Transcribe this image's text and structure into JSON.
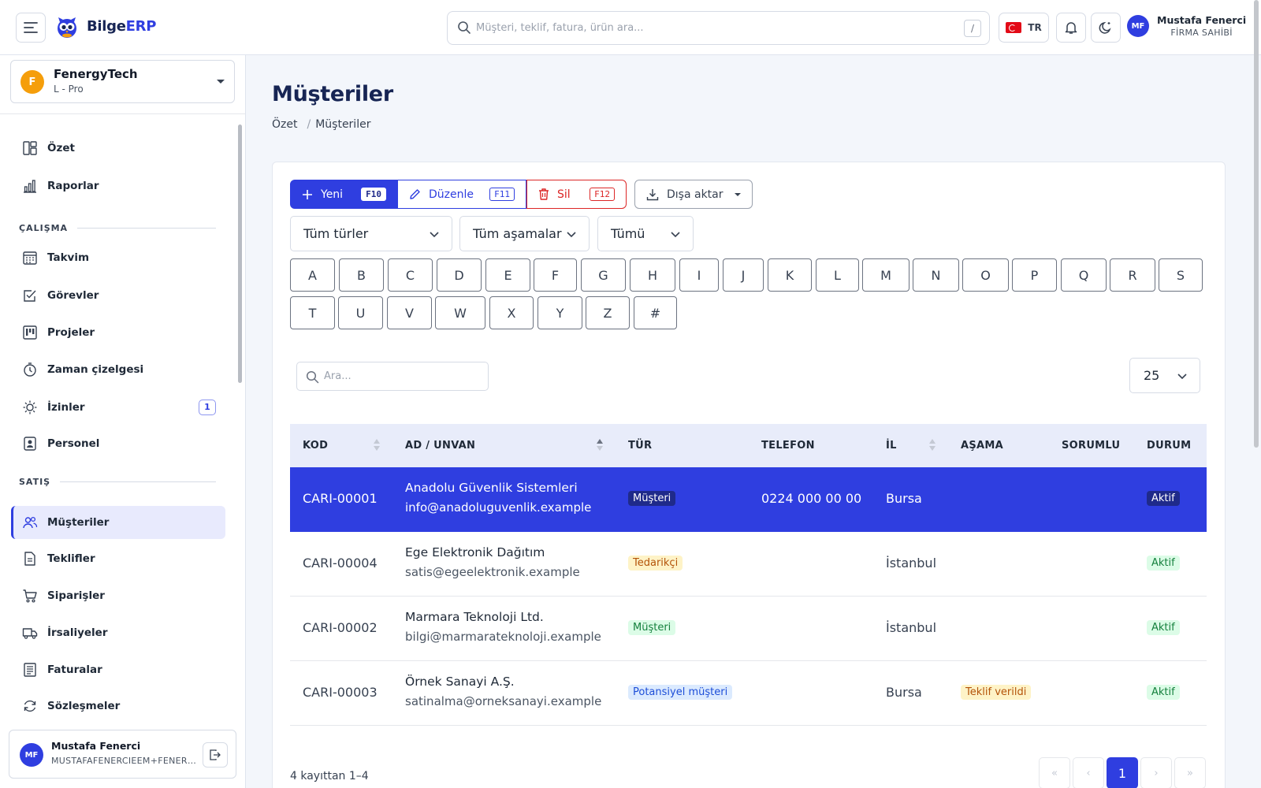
{
  "app": {
    "brand_part1": "Bilge",
    "brand_part2": "ERP"
  },
  "topbar": {
    "search_placeholder": "Müşteri, teklif, fatura, ürün ara...",
    "search_shortcut": "/",
    "language": "TR",
    "user_initials": "MF",
    "user_name": "Mustafa Fenerci",
    "user_role": "FİRMA SAHİBİ"
  },
  "company": {
    "initial": "F",
    "name": "FenergyTech",
    "plan": "L - Pro"
  },
  "sidebar": {
    "top_items": [
      {
        "label": "Özet",
        "icon": "layout-icon"
      },
      {
        "label": "Raporlar",
        "icon": "bar-chart-icon"
      }
    ],
    "sections": [
      {
        "title": "ÇALIŞMA",
        "items": [
          {
            "label": "Takvim",
            "icon": "calendar-icon"
          },
          {
            "label": "Görevler",
            "icon": "checkbox-icon"
          },
          {
            "label": "Projeler",
            "icon": "kanban-icon"
          },
          {
            "label": "Zaman çizelgesi",
            "icon": "stopwatch-icon"
          },
          {
            "label": "İzinler",
            "icon": "sun-icon",
            "badge": "1"
          },
          {
            "label": "Personel",
            "icon": "id-badge-icon"
          }
        ]
      },
      {
        "title": "SATIŞ",
        "items": [
          {
            "label": "Müşteriler",
            "icon": "users-icon",
            "active": true
          },
          {
            "label": "Teklifler",
            "icon": "document-icon"
          },
          {
            "label": "Siparişler",
            "icon": "cart-icon"
          },
          {
            "label": "İrsaliyeler",
            "icon": "truck-icon"
          },
          {
            "label": "Faturalar",
            "icon": "invoice-icon"
          },
          {
            "label": "Sözleşmeler",
            "icon": "refresh-icon"
          }
        ]
      }
    ],
    "user": {
      "initials": "MF",
      "name": "Mustafa Fenerci",
      "email": "MUSTAFAFENERCIEEM+FENERGYTECH"
    }
  },
  "page": {
    "title": "Müşteriler",
    "breadcrumb": {
      "root": "Özet",
      "separator": "/",
      "current": "Müşteriler"
    }
  },
  "toolbar": {
    "new_label": "Yeni",
    "new_key": "F10",
    "edit_label": "Düzenle",
    "edit_key": "F11",
    "delete_label": "Sil",
    "delete_key": "F12",
    "export_label": "Dışa aktar"
  },
  "filters": {
    "type": "Tüm türler",
    "stage": "Tüm aşamalar",
    "status": "Tümü"
  },
  "letters_row1": [
    "A",
    "B",
    "C",
    "D",
    "E",
    "F",
    "G",
    "H",
    "I",
    "J",
    "K",
    "L",
    "M",
    "N",
    "O",
    "P",
    "Q",
    "R",
    "S"
  ],
  "letters_row2": [
    "T",
    "U",
    "V",
    "W",
    "X",
    "Y",
    "Z",
    "#"
  ],
  "table": {
    "search_placeholder": "Ara...",
    "page_size": "25",
    "columns": {
      "code": "KOD",
      "name": "AD / UNVAN",
      "type": "TÜR",
      "phone": "TELEFON",
      "city": "İL",
      "stage": "AŞAMA",
      "owner": "SORUMLU",
      "status": "DURUM"
    },
    "rows": [
      {
        "code": "CARI-00001",
        "name": "Anadolu Güvenlik Sistemleri",
        "email": "info@anadoluguvenlik.example",
        "type": "Müşteri",
        "type_kind": "musteri",
        "phone": "0224 000 00 00",
        "city": "Bursa",
        "stage": "",
        "status": "Aktif",
        "selected": true
      },
      {
        "code": "CARI-00004",
        "name": "Ege Elektronik Dağıtım",
        "email": "satis@egeelektronik.example",
        "type": "Tedarikçi",
        "type_kind": "tedarikci",
        "phone": "",
        "city": "İstanbul",
        "stage": "",
        "status": "Aktif"
      },
      {
        "code": "CARI-00002",
        "name": "Marmara Teknoloji Ltd.",
        "email": "bilgi@marmarateknoloji.example",
        "type": "Müşteri",
        "type_kind": "musteri",
        "phone": "",
        "city": "İstanbul",
        "stage": "",
        "status": "Aktif"
      },
      {
        "code": "CARI-00003",
        "name": "Örnek Sanayi A.Ş.",
        "email": "satinalma@orneksanayi.example",
        "type": "Potansiyel müşteri",
        "type_kind": "potansiyel",
        "phone": "",
        "city": "Bursa",
        "stage": "Teklif verildi",
        "status": "Aktif"
      }
    ],
    "record_info": "4 kayıttan 1–4",
    "pagination": {
      "first": "«",
      "prev": "‹",
      "current": "1",
      "next": "›",
      "last": "»"
    }
  },
  "colors": {
    "primary": "#2f3ee0",
    "danger": "#dc2626",
    "navy": "#172554",
    "success": "#15803d"
  }
}
